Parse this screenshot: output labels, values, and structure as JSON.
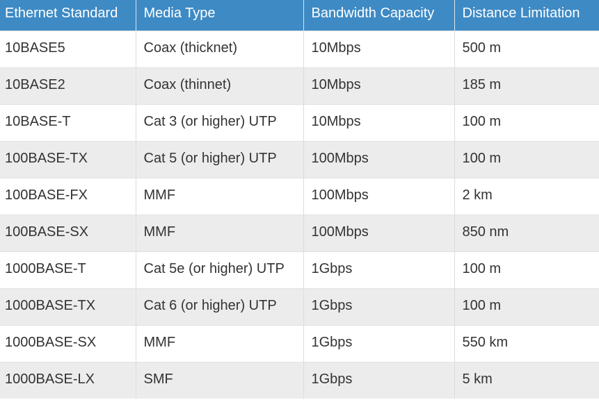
{
  "table": {
    "headers": [
      "Ethernet Standard",
      "Media Type",
      "Bandwidth Capacity",
      "Distance Limitation"
    ],
    "rows": [
      [
        "10BASE5",
        "Coax (thicknet)",
        "10Mbps",
        "500 m"
      ],
      [
        "10BASE2",
        "Coax (thinnet)",
        "10Mbps",
        "185 m"
      ],
      [
        "10BASE-T",
        "Cat 3 (or higher) UTP",
        "10Mbps",
        "100 m"
      ],
      [
        "100BASE-TX",
        "Cat 5 (or higher) UTP",
        "100Mbps",
        "100 m"
      ],
      [
        "100BASE-FX",
        "MMF",
        "100Mbps",
        "2 km"
      ],
      [
        "100BASE-SX",
        "MMF",
        "100Mbps",
        "850 nm"
      ],
      [
        "1000BASE-T",
        "Cat 5e (or higher) UTP",
        "1Gbps",
        "100 m"
      ],
      [
        "1000BASE-TX",
        "Cat 6 (or higher) UTP",
        "1Gbps",
        "100 m"
      ],
      [
        "1000BASE-SX",
        "MMF",
        "1Gbps",
        "550 km"
      ],
      [
        "1000BASE-LX",
        "SMF",
        "1Gbps",
        "5 km"
      ]
    ]
  },
  "colors": {
    "header_background": "#3e8ac4",
    "header_text": "#ffffff",
    "stripe_row": "#ececec",
    "body_text": "#333333"
  }
}
